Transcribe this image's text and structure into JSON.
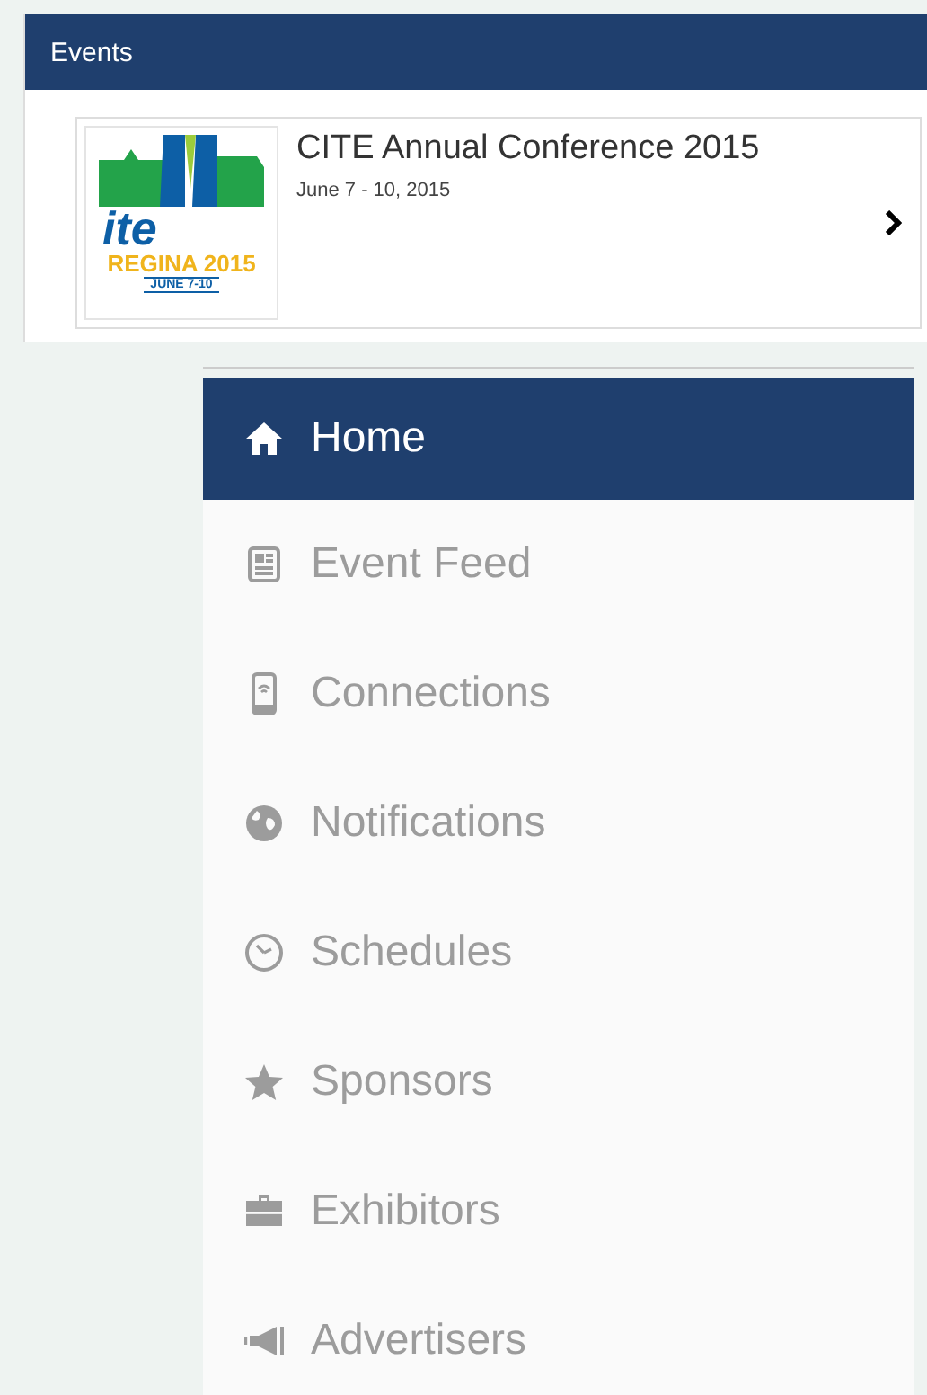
{
  "events_panel": {
    "title": "Events",
    "events": [
      {
        "logo": {
          "wordmark": "ite",
          "city_year": "REGINA 2015",
          "dates": "JUNE 7-10"
        },
        "title": "CITE Annual Conference 2015",
        "date": "June 7 - 10, 2015"
      }
    ]
  },
  "menu": {
    "items": [
      {
        "label": "Home",
        "kind": "home",
        "selected": true
      },
      {
        "label": "Event Feed",
        "kind": "feed",
        "selected": false
      },
      {
        "label": "Connections",
        "kind": "phone",
        "selected": false
      },
      {
        "label": "Notifications",
        "kind": "globe",
        "selected": false
      },
      {
        "label": "Schedules",
        "kind": "clock",
        "selected": false
      },
      {
        "label": "Sponsors",
        "kind": "star",
        "selected": false
      },
      {
        "label": "Exhibitors",
        "kind": "briefcase",
        "selected": false
      },
      {
        "label": "Advertisers",
        "kind": "megaphone",
        "selected": false
      }
    ]
  }
}
